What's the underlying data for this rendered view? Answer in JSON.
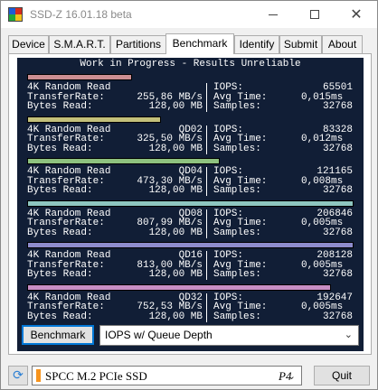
{
  "window": {
    "title": "SSD-Z 16.01.18 beta"
  },
  "tabs": [
    {
      "label": "Device"
    },
    {
      "label": "S.M.A.R.T."
    },
    {
      "label": "Partitions"
    },
    {
      "label": "Benchmark",
      "active": true
    },
    {
      "label": "Identify"
    },
    {
      "label": "Submit"
    },
    {
      "label": "About"
    }
  ],
  "benchmark": {
    "header": "Work in Progress - Results Unreliable",
    "results": [
      {
        "test": "4K Random Read",
        "qd": "",
        "bar_color": "#cc8e92",
        "bar_fraction": 0.32,
        "transfer_label": "TransferRate:",
        "transfer": "255,86 MB/s",
        "bytes_label": "Bytes Read:",
        "bytes": "128,00 MB",
        "iops_label": "IOPS:",
        "iops": "65501",
        "avg_label": "Avg Time:",
        "avg": "0,015",
        "avg_unit": "ms",
        "samples_label": "Samples:",
        "samples": "32768"
      },
      {
        "test": "4K Random Read",
        "qd": "QD02",
        "bar_color": "#c3c07b",
        "bar_fraction": 0.41,
        "transfer_label": "TransferRate:",
        "transfer": "325,50 MB/s",
        "bytes_label": "Bytes Read:",
        "bytes": "128,00 MB",
        "iops_label": "IOPS:",
        "iops": "83328",
        "avg_label": "Avg Time:",
        "avg": "0,012",
        "avg_unit": "ms",
        "samples_label": "Samples:",
        "samples": "32768"
      },
      {
        "test": "4K Random Read",
        "qd": "QD04",
        "bar_color": "#8ec27f",
        "bar_fraction": 0.59,
        "transfer_label": "TransferRate:",
        "transfer": "473,30 MB/s",
        "bytes_label": "Bytes Read:",
        "bytes": "128,00 MB",
        "iops_label": "IOPS:",
        "iops": "121165",
        "avg_label": "Avg Time:",
        "avg": "0,008",
        "avg_unit": "ms",
        "samples_label": "Samples:",
        "samples": "32768"
      },
      {
        "test": "4K Random Read",
        "qd": "QD08",
        "bar_color": "#8ec6c0",
        "bar_fraction": 1.0,
        "transfer_label": "TransferRate:",
        "transfer": "807,99 MB/s",
        "bytes_label": "Bytes Read:",
        "bytes": "128,00 MB",
        "iops_label": "IOPS:",
        "iops": "206846",
        "avg_label": "Avg Time:",
        "avg": "0,005",
        "avg_unit": "ms",
        "samples_label": "Samples:",
        "samples": "32768"
      },
      {
        "test": "4K Random Read",
        "qd": "QD16",
        "bar_color": "#8e8ccc",
        "bar_fraction": 1.0,
        "transfer_label": "TransferRate:",
        "transfer": "813,00 MB/s",
        "bytes_label": "Bytes Read:",
        "bytes": "128,00 MB",
        "iops_label": "IOPS:",
        "iops": "208128",
        "avg_label": "Avg Time:",
        "avg": "0,005",
        "avg_unit": "ms",
        "samples_label": "Samples:",
        "samples": "32768"
      },
      {
        "test": "4K Random Read",
        "qd": "QD32",
        "bar_color": "#c88ec4",
        "bar_fraction": 0.93,
        "transfer_label": "TransferRate:",
        "transfer": "752,53 MB/s",
        "bytes_label": "Bytes Read:",
        "bytes": "128,00 MB",
        "iops_label": "IOPS:",
        "iops": "192647",
        "avg_label": "Avg Time:",
        "avg": "0,005",
        "avg_unit": "ms",
        "samples_label": "Samples:",
        "samples": "32768"
      }
    ],
    "button_label": "Benchmark",
    "mode": "IOPS w/ Queue Depth"
  },
  "footer": {
    "drive_name": "SPCC M.2 PCIe SSD",
    "drive_port": "P4",
    "quit_label": "Quit"
  },
  "icons": {
    "app": "app-icon",
    "refresh": "refresh-icon",
    "dropdown": "chevron-down-icon"
  }
}
